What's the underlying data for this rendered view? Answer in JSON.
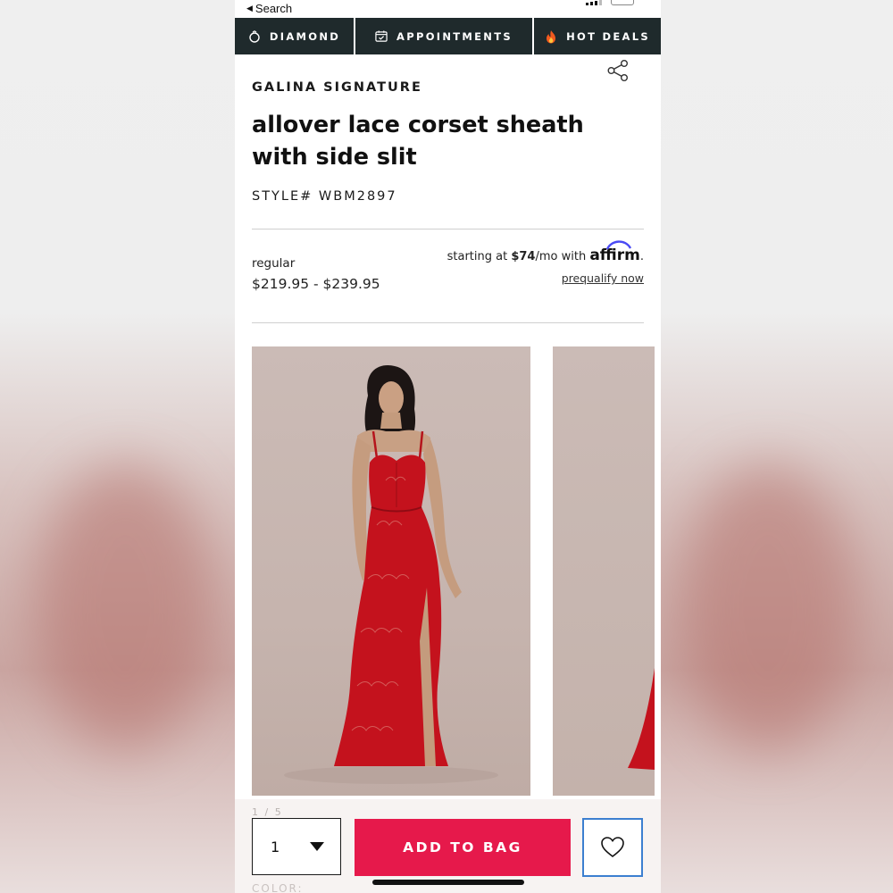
{
  "statusbar": {
    "back_label": "Search"
  },
  "navbar": {
    "items": [
      {
        "label": "DIAMOND",
        "icon": "diamond-ring-icon"
      },
      {
        "label": "APPOINTMENTS",
        "icon": "calendar-check-icon"
      },
      {
        "label": "HOT DEALS",
        "icon": "fire-icon"
      }
    ]
  },
  "product": {
    "brand": "GALINA SIGNATURE",
    "title": "allover lace corset sheath with side slit",
    "style": "STYLE# WBM2897",
    "price_label": "regular",
    "price": "$219.95 - $239.95",
    "financing_prefix": "starting at ",
    "financing_amount": "$74",
    "financing_suffix": "/mo with ",
    "financing_brand": "affirm",
    "financing_period": ".",
    "prequalify": "prequalify now",
    "image_counter": "1 / 5",
    "color_label": "COLOR:"
  },
  "cart": {
    "quantity": "1",
    "add_label": "ADD TO BAG"
  },
  "colors": {
    "nav_bg": "#1f2a2c",
    "add_button": "#e6194b",
    "dress": "#c4121d",
    "wishlist_border": "#3c7fd0"
  }
}
